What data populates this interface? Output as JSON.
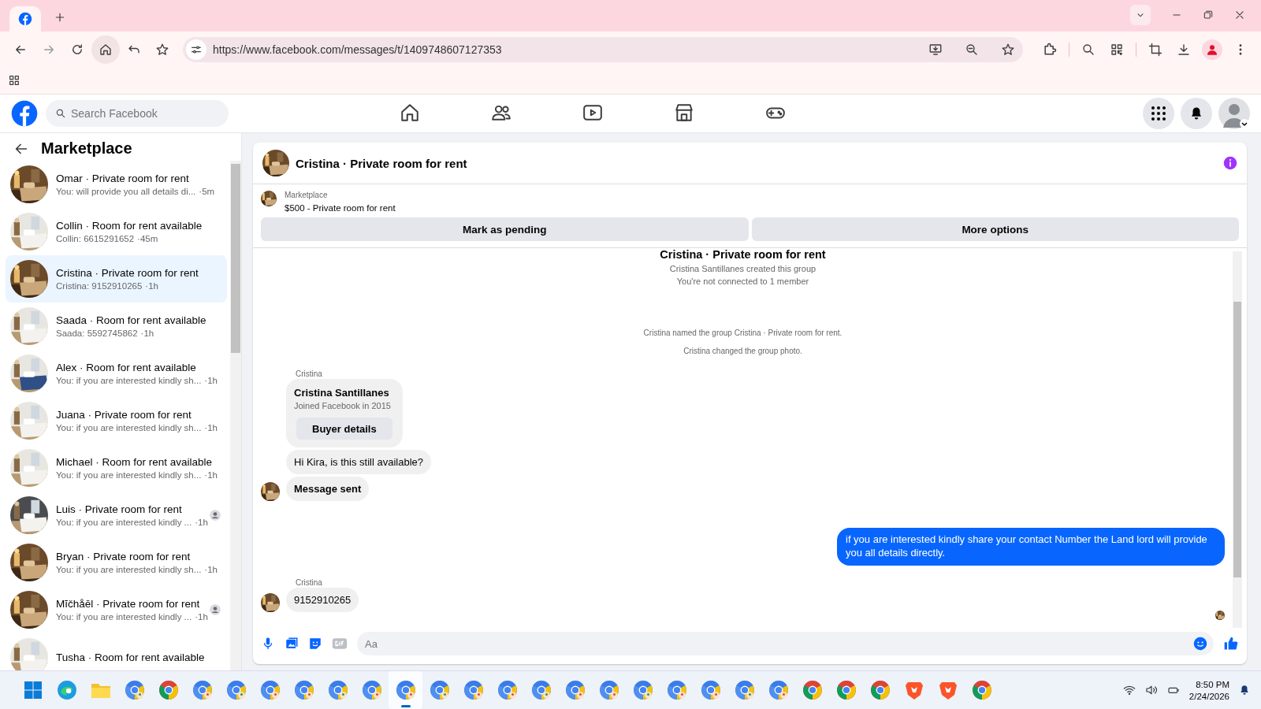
{
  "browser": {
    "url": "https://www.facebook.com/messages/t/1409748607127353"
  },
  "facebook": {
    "search": {
      "placeholder": "Search Facebook"
    },
    "nav": [
      {
        "kind": "home",
        "selected": false
      },
      {
        "kind": "friends",
        "selected": false
      },
      {
        "kind": "video",
        "selected": false
      },
      {
        "kind": "marketplace",
        "selected": false
      },
      {
        "kind": "gaming",
        "selected": false
      }
    ]
  },
  "sidebar": {
    "title": "Marketplace",
    "conversations": [
      {
        "title": "Omar · Private room for rent",
        "preview": "You: will provide you all details di...",
        "time": "·5m",
        "selected": false
      },
      {
        "title": "Collin · Room for rent available",
        "preview": "Collin: 6615291652",
        "time": "·45m",
        "selected": false
      },
      {
        "title": "Cristina · Private room for rent",
        "preview": "Cristina: 9152910265",
        "time": "·1h",
        "selected": true
      },
      {
        "title": "Saada · Room for rent available",
        "preview": "Saada: 5592745862",
        "time": "·1h",
        "selected": false
      },
      {
        "title": "Alex · Room for rent available",
        "preview": "You: if you are interested kindly sh...",
        "time": "·1h",
        "selected": false
      },
      {
        "title": "Juana · Private room for rent",
        "preview": "You: if you are interested kindly sh...",
        "time": "·1h",
        "selected": false
      },
      {
        "title": "Michael · Room for rent available",
        "preview": "You: if you are interested kindly sh...",
        "time": "·1h",
        "selected": false
      },
      {
        "title": "Luis · Private room for rent",
        "preview": "You: if you are interested kindly ...",
        "time": "·1h",
        "selected": false,
        "seen": true
      },
      {
        "title": "Bryan · Private room for rent",
        "preview": "You: if you are interested kindly sh...",
        "time": "·1h",
        "selected": false
      },
      {
        "title": "Mĭčhåēl · Private room for rent",
        "preview": "You: if you are interested kindly ...",
        "time": "·1h",
        "selected": false,
        "seen": true
      },
      {
        "title": "Tusha · Room for rent available",
        "selected": false
      }
    ]
  },
  "chat": {
    "title": "Cristina · Private room for rent",
    "listing": {
      "source": "Marketplace",
      "item": "$500 - Private room for rent"
    },
    "actions": [
      "Mark as pending",
      "More options"
    ],
    "messages": [
      {
        "kind": "heading",
        "text": "Cristina · Private room for rent"
      },
      {
        "kind": "system",
        "text": "Cristina Santillanes created this group"
      },
      {
        "kind": "system",
        "text": "You're not connected to 1 member"
      },
      {
        "kind": "gap"
      },
      {
        "kind": "notice",
        "text": "Cristina named the group Cristina · Private room for rent."
      },
      {
        "kind": "notice",
        "text": "Cristina changed the group photo."
      },
      {
        "kind": "sender",
        "text": "Cristina"
      },
      {
        "kind": "card",
        "name": "Cristina Santillanes",
        "detail": "Joined Facebook in 2015",
        "button": "Buyer details"
      },
      {
        "kind": "incoming",
        "text": "Hi Kira, is this still available?",
        "avatar": false,
        "bold": false
      },
      {
        "kind": "incoming",
        "text": "Message sent",
        "avatar": true,
        "bold": true
      },
      {
        "kind": "outgoing",
        "text": "if you are interested kindly share your contact Number the Land lord will provide you all details directly."
      },
      {
        "kind": "sender",
        "text": "Cristina"
      },
      {
        "kind": "incoming",
        "text": "9152910265",
        "avatar": true,
        "bold": false
      },
      {
        "kind": "seen"
      }
    ],
    "composer": {
      "placeholder": "Aa"
    }
  },
  "taskbar": {
    "apps": [
      {
        "kind": "start",
        "selected": false
      },
      {
        "kind": "edge",
        "selected": false
      },
      {
        "kind": "folder",
        "selected": false
      },
      {
        "kind": "profile",
        "selected": false
      },
      {
        "kind": "chrome",
        "selected": false
      },
      {
        "kind": "profile",
        "selected": false
      },
      {
        "kind": "profile",
        "selected": false
      },
      {
        "kind": "profile",
        "selected": false
      },
      {
        "kind": "profile",
        "selected": false
      },
      {
        "kind": "profile",
        "selected": false
      },
      {
        "kind": "profile",
        "selected": false
      },
      {
        "kind": "profile",
        "selected": true
      },
      {
        "kind": "profile",
        "selected": false
      },
      {
        "kind": "profile",
        "selected": false
      },
      {
        "kind": "profile",
        "selected": false
      },
      {
        "kind": "profile",
        "selected": false
      },
      {
        "kind": "profile",
        "selected": false
      },
      {
        "kind": "profile",
        "selected": false
      },
      {
        "kind": "profile",
        "selected": false
      },
      {
        "kind": "profile",
        "selected": false
      },
      {
        "kind": "profile",
        "selected": false
      },
      {
        "kind": "profile",
        "selected": false
      },
      {
        "kind": "profile",
        "selected": false
      },
      {
        "kind": "chrome",
        "selected": false
      },
      {
        "kind": "chrome",
        "selected": false
      },
      {
        "kind": "chrome",
        "selected": false
      },
      {
        "kind": "brave",
        "selected": false
      },
      {
        "kind": "brave",
        "selected": false
      },
      {
        "kind": "chrome",
        "selected": false
      }
    ],
    "time": "8:50 PM",
    "date": "2/24/2026"
  }
}
